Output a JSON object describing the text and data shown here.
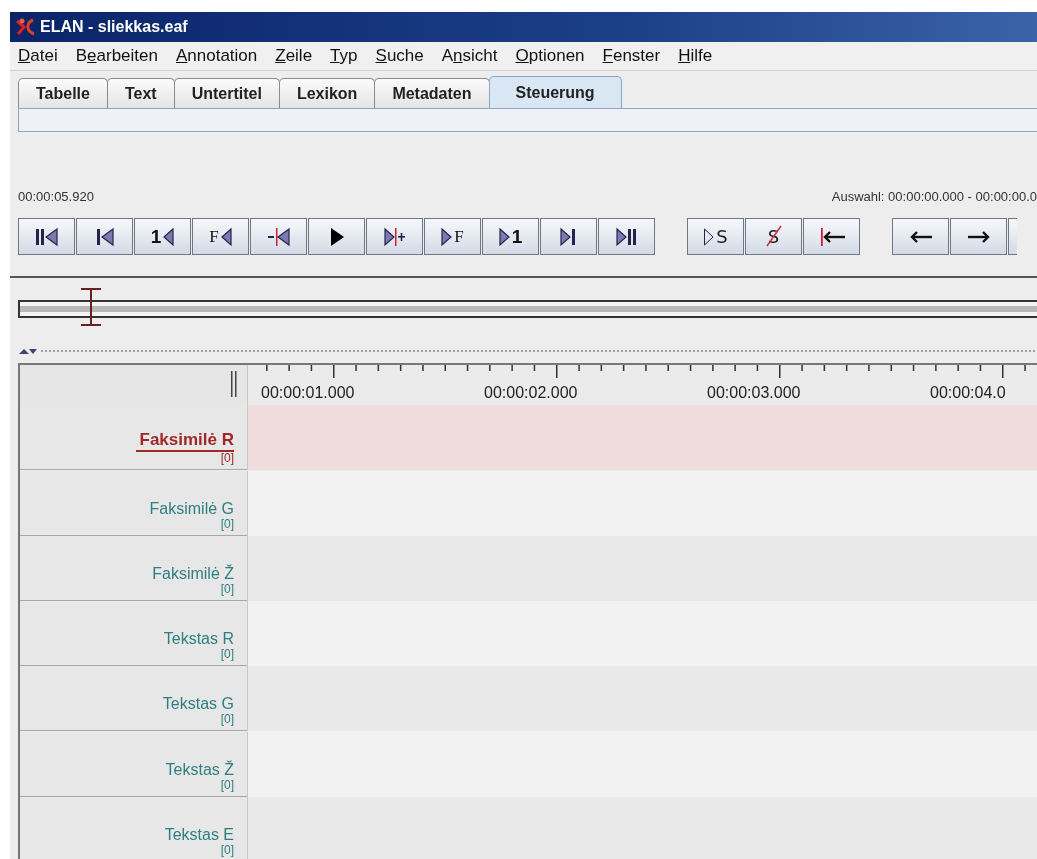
{
  "window": {
    "title": "ELAN - sliekkas.eaf"
  },
  "menu": [
    {
      "key": "D",
      "post": "atei"
    },
    {
      "pre": "B",
      "key": "e",
      "post": "arbeiten"
    },
    {
      "key": "A",
      "post": "nnotation"
    },
    {
      "key": "Z",
      "post": "eile"
    },
    {
      "key": "T",
      "post": "yp"
    },
    {
      "key": "S",
      "post": "uche"
    },
    {
      "pre": "A",
      "key": "n",
      "post": "sicht"
    },
    {
      "key": "O",
      "post": "ptionen"
    },
    {
      "key": "F",
      "post": "enster"
    },
    {
      "key": "H",
      "post": "ilfe"
    }
  ],
  "tabs": [
    {
      "label": "Tabelle",
      "selected": false
    },
    {
      "label": "Text",
      "selected": false
    },
    {
      "label": "Untertitel",
      "selected": false
    },
    {
      "label": "Lexikon",
      "selected": false
    },
    {
      "label": "Metadaten",
      "selected": false
    },
    {
      "label": "Steuerung",
      "selected": true
    }
  ],
  "media_time": "00:00:05.920",
  "selection_time": "Auswahl: 00:00:00.000 - 00:00:00.0",
  "button_groups": [
    [
      {
        "kind": "begin"
      },
      {
        "kind": "back_bar"
      },
      {
        "kind": "back_digit",
        "text": "1"
      },
      {
        "kind": "back_letter",
        "text": "F"
      },
      {
        "kind": "back_red"
      },
      {
        "kind": "play"
      },
      {
        "kind": "fwd_red"
      },
      {
        "kind": "fwd_letter",
        "text": "F"
      },
      {
        "kind": "fwd_digit",
        "text": "1"
      },
      {
        "kind": "fwd_bar"
      },
      {
        "kind": "end"
      }
    ],
    [
      {
        "kind": "play_text",
        "text": "S"
      },
      {
        "kind": "struck_text",
        "text": "S"
      },
      {
        "kind": "red_bar_arrow"
      }
    ],
    [
      {
        "kind": "arrow_left"
      },
      {
        "kind": "arrow_right"
      },
      {
        "kind": "partial"
      }
    ]
  ],
  "ruler": {
    "labels": [
      "00:00:01.000",
      "00:00:02.000",
      "00:00:03.000",
      "00:00:04.0"
    ]
  },
  "tiers": [
    {
      "name": "Faksimilė R",
      "count": "[0]",
      "selected": true
    },
    {
      "name": "Faksimilė G",
      "count": "[0]",
      "selected": false
    },
    {
      "name": "Faksimilė Ž",
      "count": "[0]",
      "selected": false
    },
    {
      "name": "Tekstas R",
      "count": "[0]",
      "selected": false
    },
    {
      "name": "Tekstas G",
      "count": "[0]",
      "selected": false
    },
    {
      "name": "Tekstas Ž",
      "count": "[0]",
      "selected": false
    },
    {
      "name": "Tekstas E",
      "count": "[0]",
      "selected": false
    }
  ]
}
